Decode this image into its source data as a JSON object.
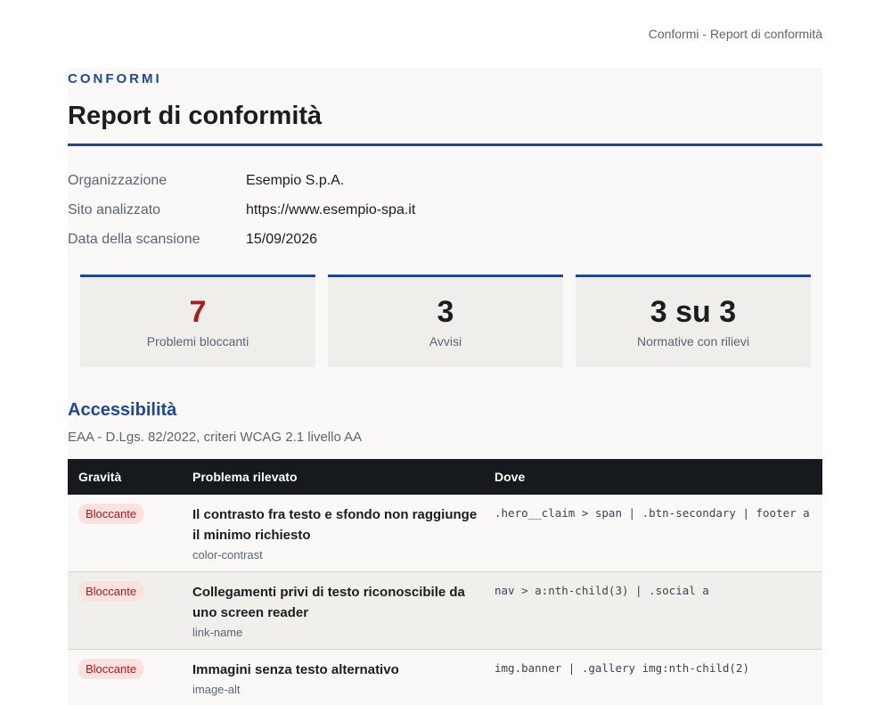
{
  "running_header": "Conformi - Report di conformità",
  "brand": "CONFORMI",
  "title": "Report di conformità",
  "meta": [
    {
      "label": "Organizzazione",
      "value": "Esempio S.p.A."
    },
    {
      "label": "Sito analizzato",
      "value": "https://www.esempio-spa.it"
    },
    {
      "label": "Data della scansione",
      "value": "15/09/2026"
    }
  ],
  "summary": [
    {
      "value": "7",
      "label": "Problemi bloccanti"
    },
    {
      "value": "3",
      "label": "Avvisi"
    },
    {
      "value": "3 su 3",
      "label": "Normative con rilievi"
    }
  ],
  "section": {
    "title": "Accessibilità",
    "subtitle": "EAA - D.Lgs. 82/2022, criteri WCAG 2.1 livello AA"
  },
  "table": {
    "headers": [
      "Gravità",
      "Problema rilevato",
      "Dove"
    ],
    "rows": [
      {
        "severity": "Bloccante",
        "title": "Il contrasto fra testo e sfondo non raggiunge il minimo richiesto",
        "code": "color-contrast",
        "where": ".hero__claim > span | .btn-secondary | footer a"
      },
      {
        "severity": "Bloccante",
        "title": "Collegamenti privi di testo riconoscibile da uno screen reader",
        "code": "link-name",
        "where": "nav > a:nth-child(3) | .social a"
      },
      {
        "severity": "Bloccante",
        "title": "Immagini senza testo alternativo",
        "code": "image-alt",
        "where": "img.banner | .gallery img:nth-child(2)"
      }
    ]
  },
  "colors": {
    "accent": "#1e4896",
    "danger": "#a32020",
    "header_bg": "#16191d"
  }
}
